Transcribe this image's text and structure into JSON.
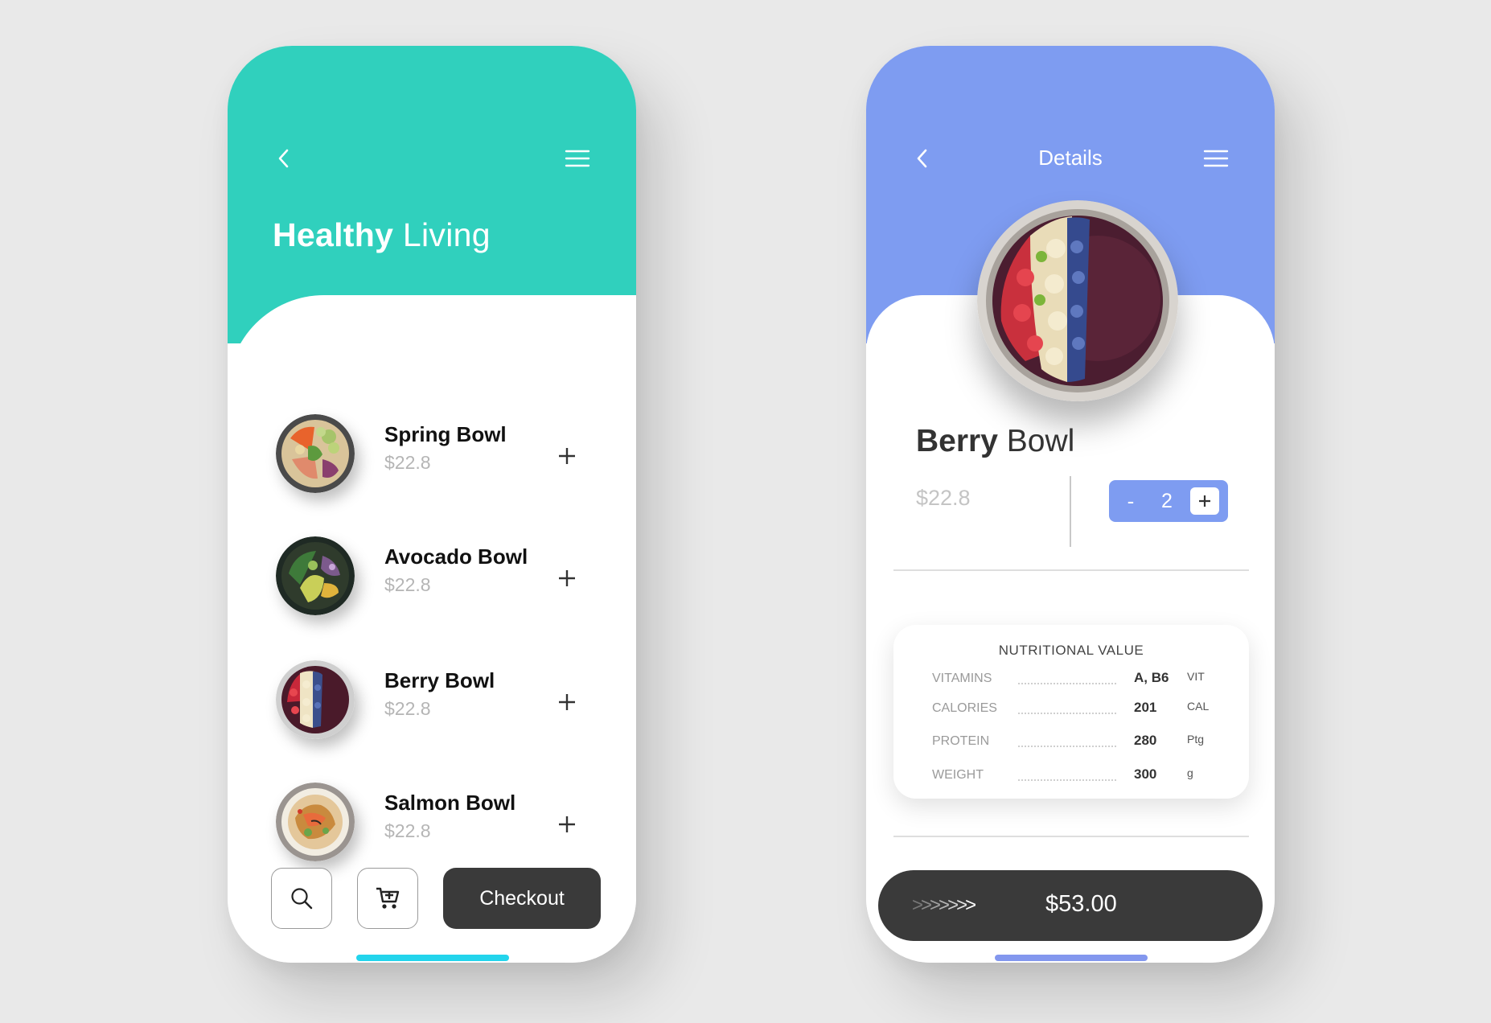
{
  "colors": {
    "teal": "#30d0bd",
    "periwinkle": "#7e9cf1",
    "dark": "#3a3a3a",
    "muted_price": "#b5b5b5",
    "home_indicator_left": "#23d4ec",
    "home_indicator_right": "#8397ee"
  },
  "list_screen": {
    "title_bold": "Healthy",
    "title_light": " Living",
    "back_icon": "chevron-left-icon",
    "menu_icon": "hamburger-menu-icon",
    "items": [
      {
        "name": "Spring Bowl",
        "price": "$22.8",
        "image": "spring-bowl-thumbnail"
      },
      {
        "name": "Avocado Bowl",
        "price": "$22.8",
        "image": "avocado-bowl-thumbnail"
      },
      {
        "name": "Berry Bowl",
        "price": "$22.8",
        "image": "berry-bowl-thumbnail"
      },
      {
        "name": "Salmon Bowl",
        "price": "$22.8",
        "image": "salmon-bowl-thumbnail"
      }
    ],
    "search_icon": "search-icon",
    "cart_icon": "cart-add-icon",
    "checkout_label": "Checkout"
  },
  "detail_screen": {
    "header_title": "Details",
    "product_bold": "Berry",
    "product_light": " Bowl",
    "price": "$22.8",
    "quantity_minus": "-",
    "quantity": "2",
    "quantity_plus": "+",
    "nutrition": {
      "title": "NUTRITIONAL VALUE",
      "rows": [
        {
          "label": "VITAMINS",
          "value": "A, B6",
          "unit": "VIT"
        },
        {
          "label": "CALORIES",
          "value": "201",
          "unit": "CAL"
        },
        {
          "label": "PROTEIN",
          "value": "280",
          "unit": "Ptg"
        },
        {
          "label": "WEIGHT",
          "value": "300",
          "unit": "g"
        }
      ]
    },
    "swipe_arrows": ">>>>>>>",
    "total": "$53.00"
  }
}
